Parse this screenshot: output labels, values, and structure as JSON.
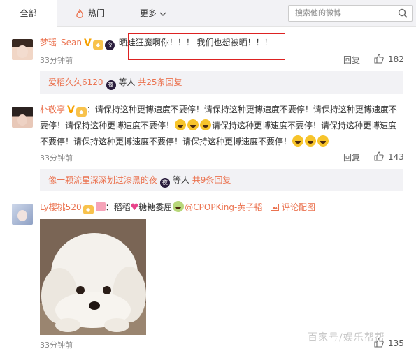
{
  "tabs": {
    "all": "全部",
    "hot": "热门",
    "more": "更多"
  },
  "search": {
    "placeholder": "搜索他的微博"
  },
  "comments": [
    {
      "user": "梦瑶_Sean",
      "text": "晒娃狂魔啊你！！！ 我们也想被晒！！！",
      "time": "33分钟前",
      "reply_label": "回复",
      "likes": "182",
      "replies_summary": {
        "name": "爱稻久久6120",
        "middle": "等人",
        "count": "共25条回复"
      }
    },
    {
      "user": "朴敬亭",
      "text_line1": "：请保持这种更博速度不要停！请保持这种更博速度不要停！请保持这种更博速度不",
      "text_line2a": "要停！请保持这种更博速度不要停！",
      "text_line2b": "请保持这种更博速度不要停！请保持这种更博速度",
      "text_line3": "不要停！请保持这种更博速度不要停！请保持这种更博速度不要停！",
      "time": "33分钟前",
      "reply_label": "回复",
      "likes": "143",
      "replies_summary": {
        "name": "像一颗流星深深划过漆黑的夜",
        "middle": "等人",
        "count": "共9条回复"
      }
    },
    {
      "user": "Ly樱桃520",
      "text_a": "：稻稻",
      "text_b": "糖糖委屈",
      "mention": "@CPOPKing-黄子韬",
      "pic_label": "评论配图",
      "time": "33分钟前",
      "likes": "135"
    }
  ],
  "watermark": "百家号/娱乐帮帮",
  "colors": {
    "username": "#eb7350",
    "highlight_border": "#dd2222",
    "topbar_bg": "#f2f2f5"
  }
}
